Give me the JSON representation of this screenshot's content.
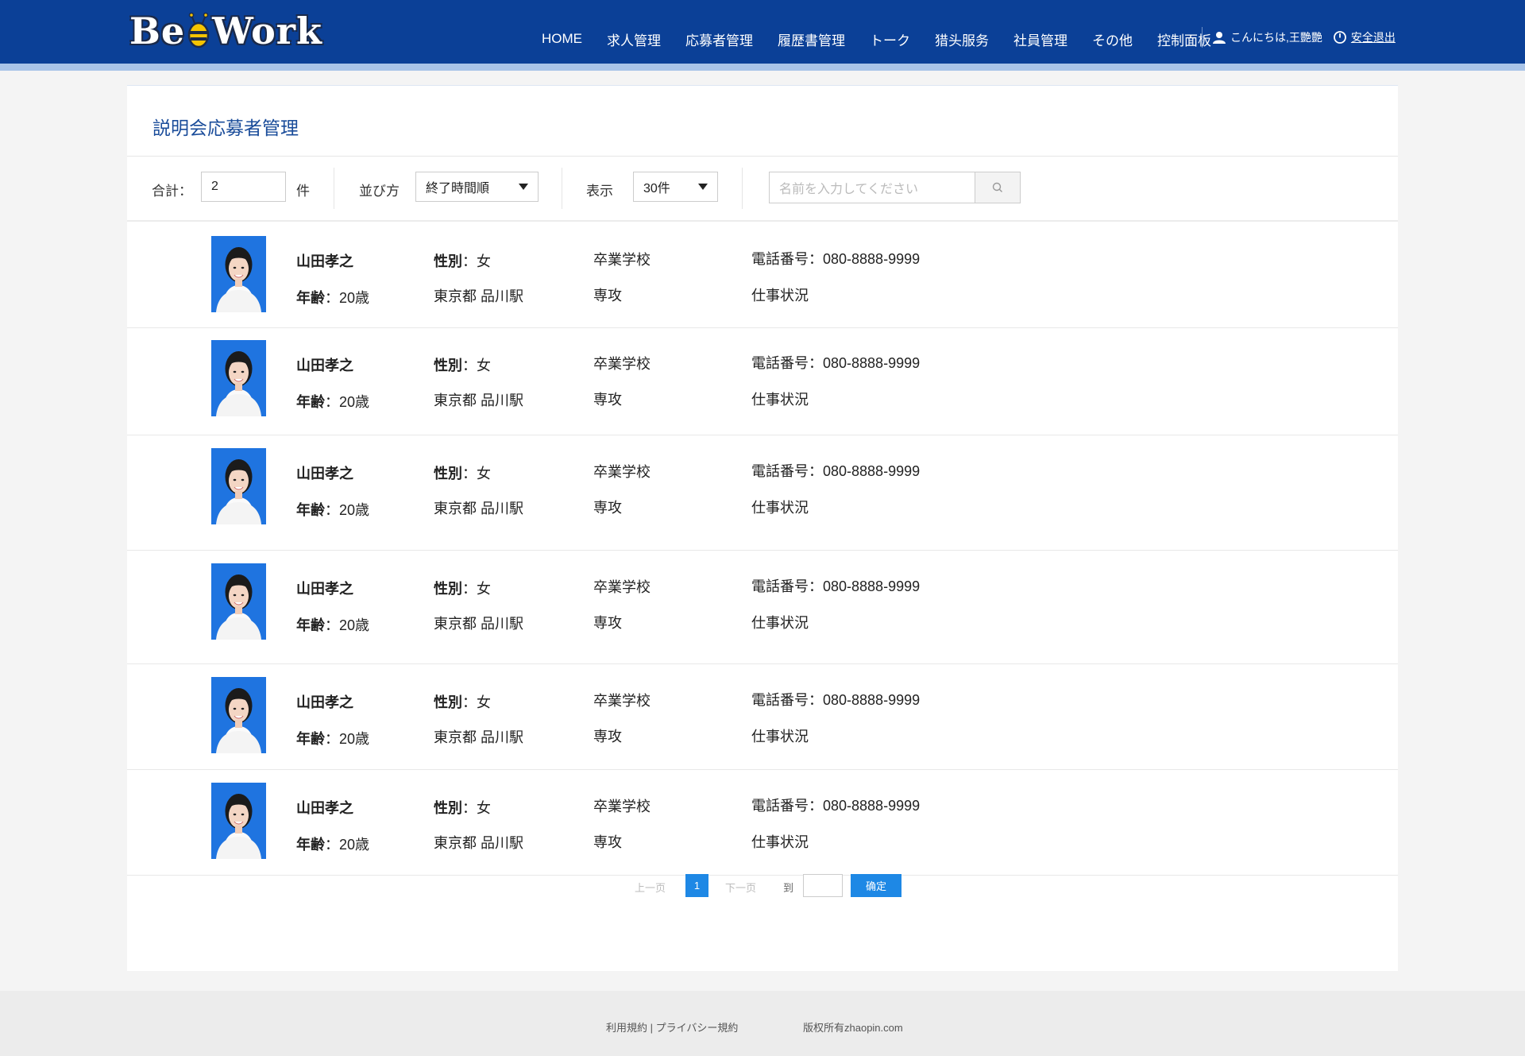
{
  "header": {
    "logo_text_1": "Be",
    "logo_text_2": "Work",
    "nav": [
      "HOME",
      "求人管理",
      "応募者管理",
      "履歴書管理",
      "トーク",
      "猎头服务",
      "社員管理",
      "その他",
      "控制面板"
    ],
    "greeting": "こんにちは,王艷艷",
    "logout": "安全退出"
  },
  "page": {
    "title": "説明会応募者管理"
  },
  "filters": {
    "total_label": "合計：",
    "total_value": "2",
    "total_unit": "件",
    "sort_label": "並び方",
    "sort_value": "終了時間順",
    "display_label": "表示",
    "display_value": "30件",
    "search_placeholder": "名前を入力してください"
  },
  "applicants": [
    {
      "name": "山田孝之",
      "age_label": "年齢",
      "age": "20歳",
      "gender_label": "性別",
      "gender": "女",
      "location": "東京都 品川駅",
      "school": "卒業学校",
      "major": "専攻",
      "phone_label": "電話番号",
      "phone": "080-8888-9999",
      "work_status": "仕事状況"
    },
    {
      "name": "山田孝之",
      "age_label": "年齢",
      "age": "20歳",
      "gender_label": "性別",
      "gender": "女",
      "location": "東京都 品川駅",
      "school": "卒業学校",
      "major": "専攻",
      "phone_label": "電話番号",
      "phone": "080-8888-9999",
      "work_status": "仕事状況"
    },
    {
      "name": "山田孝之",
      "age_label": "年齢",
      "age": "20歳",
      "gender_label": "性別",
      "gender": "女",
      "location": "東京都 品川駅",
      "school": "卒業学校",
      "major": "専攻",
      "phone_label": "電話番号",
      "phone": "080-8888-9999",
      "work_status": "仕事状況"
    },
    {
      "name": "山田孝之",
      "age_label": "年齢",
      "age": "20歳",
      "gender_label": "性別",
      "gender": "女",
      "location": "東京都 品川駅",
      "school": "卒業学校",
      "major": "専攻",
      "phone_label": "電話番号",
      "phone": "080-8888-9999",
      "work_status": "仕事状況"
    },
    {
      "name": "山田孝之",
      "age_label": "年齢",
      "age": "20歳",
      "gender_label": "性別",
      "gender": "女",
      "location": "東京都 品川駅",
      "school": "卒業学校",
      "major": "専攻",
      "phone_label": "電話番号",
      "phone": "080-8888-9999",
      "work_status": "仕事状況"
    },
    {
      "name": "山田孝之",
      "age_label": "年齢",
      "age": "20歳",
      "gender_label": "性別",
      "gender": "女",
      "location": "東京都 品川駅",
      "school": "卒業学校",
      "major": "専攻",
      "phone_label": "電話番号",
      "phone": "080-8888-9999",
      "work_status": "仕事状況"
    }
  ],
  "pagination": {
    "prev": "上一页",
    "current": "1",
    "next": "下一页",
    "goto": "到",
    "confirm": "确定"
  },
  "footer": {
    "terms": "利用規約",
    "separator": "|",
    "privacy": "プライバシー規約",
    "copyright": "版权所有zhaopin.com"
  },
  "colors": {
    "header_bg": "#0b4097",
    "accent": "#1e88e5",
    "title": "#1a4c9a"
  }
}
